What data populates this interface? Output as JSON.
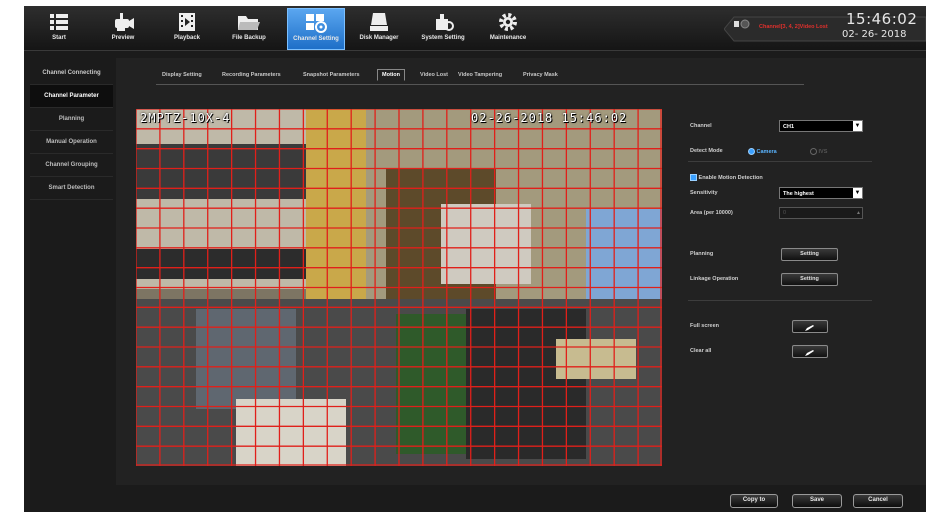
{
  "nav": [
    {
      "label": "Start",
      "icon": "menu-icon"
    },
    {
      "label": "Preview",
      "icon": "camera-icon"
    },
    {
      "label": "Playback",
      "icon": "film-icon"
    },
    {
      "label": "File Backup",
      "icon": "folder-icon"
    },
    {
      "label": "Channel Setting",
      "icon": "channel-setting-icon"
    },
    {
      "label": "Disk Manager",
      "icon": "disk-icon"
    },
    {
      "label": "System Setting",
      "icon": "system-setting-icon"
    },
    {
      "label": "Maintenance",
      "icon": "gear-icon"
    }
  ],
  "status": {
    "text": "Channel[3, 4, 2]Video Lost",
    "color": "#e0302c"
  },
  "clock": {
    "time": "15:46:02",
    "date": "02- 26- 2018"
  },
  "sidebar": [
    "Channel Connecting",
    "Channel Parameter",
    "Planning",
    "Manual Operation",
    "Channel Grouping",
    "Smart Detection"
  ],
  "tabs": [
    "Display Setting",
    "Recording Parameters",
    "Snapshot Parameters",
    "Motion",
    "Video Lost",
    "Video Tampering",
    "Privacy Mask"
  ],
  "video": {
    "osd_name": "2MPTZ-10X-4",
    "osd_time": "02-26-2018 15:46:02",
    "grid_color": "#e0201a",
    "grid_cols": 22,
    "grid_rows": 18
  },
  "settings": {
    "channel_label": "Channel",
    "channel_value": "CH1",
    "detect_mode_label": "Detect Mode",
    "detect_camera": "Camera",
    "detect_ivs": "IVS",
    "enable_motion": "Enable Motion Detection",
    "sensitivity_label": "Sensitivity",
    "sensitivity_value": "The highest",
    "area_label": "Area (per 10000)",
    "area_value": "0",
    "planning_label": "Planning",
    "planning_btn": "Setting",
    "linkage_label": "Linkage Operation",
    "linkage_btn": "Setting",
    "fullscreen_label": "Full screen",
    "clearall_label": "Clear all"
  },
  "footer": {
    "copy": "Copy to",
    "save": "Save",
    "cancel": "Cancel"
  },
  "colors": {
    "accent": "#3aa0ff",
    "active_tab_bg": "#1e6fc8",
    "alert": "#e0302c"
  }
}
